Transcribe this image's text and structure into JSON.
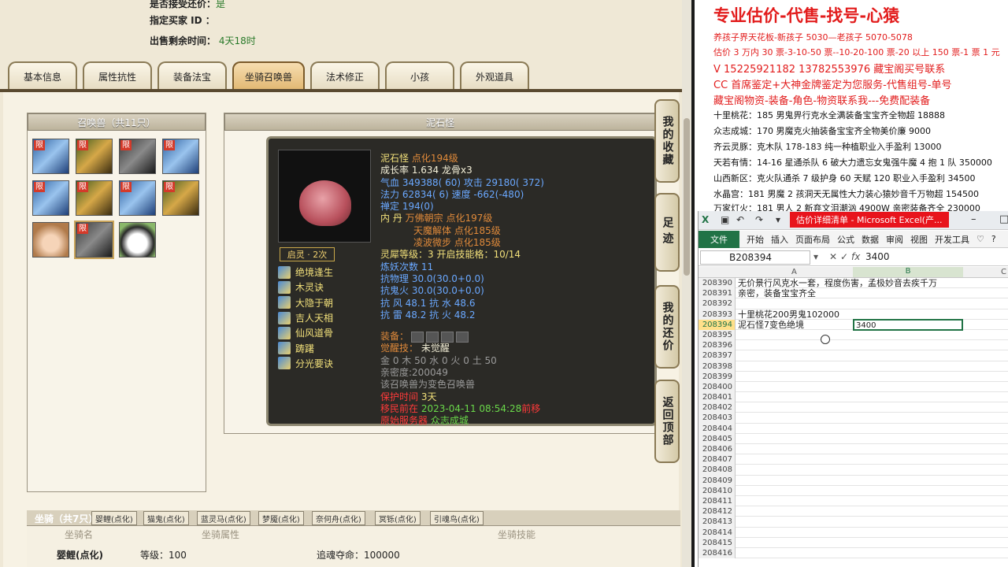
{
  "left": {
    "info": {
      "row1_label": "是否接受还价：",
      "row1_value": "是",
      "buyer_label": "指定买家 ID ：",
      "time_label": "出售剩余时间：",
      "time_value": "4天18时"
    },
    "tabs": [
      "基本信息",
      "属性抗性",
      "装备法宝",
      "坐骑召唤兽",
      "法术修正",
      "小孩",
      "外观道具"
    ],
    "active_tab": "坐骑召唤兽",
    "beast_list_title": "召唤兽（共11只）",
    "limit_badge": "限",
    "detail_title": "泥石怪",
    "card": {
      "name": "泥石怪",
      "dianhua": "点化194级",
      "growth": "成长率 1.634 龙骨x3",
      "hp": "气血 349388( 60) 攻击 29180( 372)",
      "mp": "法力 62834( 6) 速度 -662(-480)",
      "chan": "禅定 194(0)",
      "neidan_label": "内 丹",
      "neidan": [
        "万佛朝宗 点化197级",
        "天魔解体 点化185级",
        "凌波微步 点化185级"
      ],
      "lingxi": "灵犀等级：3 开启技能格：10/14",
      "lianyao": "炼妖次数 11",
      "res1": "抗物理 30.0(30.0+0.0)",
      "res2": "抗鬼火 30.0(30.0+0.0)",
      "res3": "抗 风 48.1 抗 水 48.6",
      "res4": "抗 雷 48.2 抗 火 48.2",
      "equip_label": "装备：",
      "awake_label": "觉醒技：",
      "awake_value": "未觉醒",
      "elements": "金 0 木 50 水 0 火 0 土 50",
      "intimacy": "亲密度:200049",
      "variant": "该召唤兽为变色召唤兽",
      "protect_label": "保护时间",
      "protect_value": "3天",
      "migrate_label": "移民前在",
      "migrate_time": "2023-04-11 08:54:28",
      "migrate_suffix": "前移",
      "server_label": "原始服务器",
      "server_value": "众志成城",
      "qiling": "启灵 · 2次",
      "skills": [
        "绝境逢生",
        "木灵诀",
        "大隐于朝",
        "吉人天相",
        "仙风道骨",
        "踌躇",
        "分光要诀"
      ]
    },
    "side_buttons": [
      "我的收藏",
      "足迹",
      "我的还价",
      "返回顶部"
    ],
    "mount": {
      "title": "坐骑（共7只）",
      "tabs": [
        "婴鲤(点化)",
        "猫鬼(点化)",
        "蓝灵马(点化)",
        "梦魇(点化)",
        "奈何舟(点化)",
        "冥铄(点化)",
        "引魂鸟(点化)"
      ],
      "col_name": "坐骑名",
      "col_attr": "坐骑属性",
      "col_skill": "坐骑技能",
      "row_name": "婴鲤(点化)",
      "row_level": "等级：100",
      "row_skill": "追魂夺命：100000"
    }
  },
  "right": {
    "headline": "专业估价-代售-找号-心猿",
    "lines": [
      "养孩子界天花板-新孩子 5030—老孩子 5070-5078",
      "估价 3 万内 30 票-3-10-50 票--10-20-100 票-20 以上 150 票-1 票 1 元",
      "V 15225921182      13782553976    藏宝阁买号联系",
      "CC 首席鉴定+大神金牌鉴定为您服务-代售组号-单号",
      "藏宝阁物资-装备-角色-物资联系我---免费配装备"
    ],
    "black_lines": [
      "十里桃花：185 男鬼畀行克水全满装备宝宝齐全物超 18888",
      "众志成城：170 男魔克火抽装备宝宝齐全物美价廉 9000",
      "齐云灵豚：克木队 178-183 纯一种植职业入手盈利 13000",
      "天若有情：14-16 星通杀队 6 破大力遗忘女鬼强牛魔 4 抱 1 队 350000",
      "山西新区：克火队通杀 7 级护身 60 天赋 120 职业入手盈利 34500",
      "水晶宫：181 男魔 2 孩洞天无属性大力装心猿妙音千万物超 154500",
      "万家灯火：181 男人 2 新弃文泪潮汹 4900W 亲密装备齐全 230000"
    ]
  },
  "excel": {
    "title": "估价详细清单 - Microsoft Excel(产...",
    "ribbon": [
      "文件",
      "开始",
      "插入",
      "页面布局",
      "公式",
      "数据",
      "审阅",
      "视图",
      "开发工具"
    ],
    "namebox": "B208394",
    "formula": "3400",
    "col_a": "A",
    "col_b": "B",
    "col_c": "C",
    "rows": [
      {
        "n": "208390",
        "a": "无价景行风克水一套，程度伤害，孟极妙音去疾千万",
        "b": ""
      },
      {
        "n": "208391",
        "a": "亲密，装备宝宝齐全",
        "b": ""
      },
      {
        "n": "208392",
        "a": "",
        "b": ""
      },
      {
        "n": "208393",
        "a": "十里桃花200男鬼102000",
        "b": ""
      },
      {
        "n": "208394",
        "a": "泥石怪7变色绝境",
        "b": "3400"
      },
      {
        "n": "208395",
        "a": "",
        "b": ""
      },
      {
        "n": "208396",
        "a": "",
        "b": ""
      },
      {
        "n": "208397",
        "a": "",
        "b": ""
      },
      {
        "n": "208398",
        "a": "",
        "b": ""
      },
      {
        "n": "208399",
        "a": "",
        "b": ""
      },
      {
        "n": "208400",
        "a": "",
        "b": ""
      },
      {
        "n": "208401",
        "a": "",
        "b": ""
      },
      {
        "n": "208402",
        "a": "",
        "b": ""
      },
      {
        "n": "208403",
        "a": "",
        "b": ""
      },
      {
        "n": "208404",
        "a": "",
        "b": ""
      },
      {
        "n": "208405",
        "a": "",
        "b": ""
      },
      {
        "n": "208406",
        "a": "",
        "b": ""
      },
      {
        "n": "208407",
        "a": "",
        "b": ""
      },
      {
        "n": "208408",
        "a": "",
        "b": ""
      },
      {
        "n": "208409",
        "a": "",
        "b": ""
      },
      {
        "n": "208410",
        "a": "",
        "b": ""
      },
      {
        "n": "208411",
        "a": "",
        "b": ""
      },
      {
        "n": "208412",
        "a": "",
        "b": ""
      },
      {
        "n": "208413",
        "a": "",
        "b": ""
      },
      {
        "n": "208414",
        "a": "",
        "b": ""
      },
      {
        "n": "208415",
        "a": "",
        "b": ""
      },
      {
        "n": "208416",
        "a": "",
        "b": ""
      }
    ]
  }
}
